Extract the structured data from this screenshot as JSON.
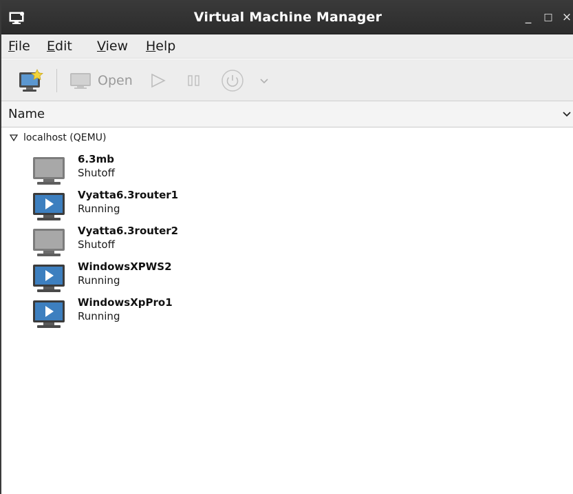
{
  "window": {
    "title": "Virtual Machine Manager",
    "minimize_label": "_",
    "maximize_label": "□",
    "close_label": "×"
  },
  "menubar": {
    "items": [
      {
        "mnemonic": "F",
        "rest": "ile"
      },
      {
        "mnemonic": "E",
        "rest": "dit"
      },
      {
        "mnemonic": "V",
        "rest": "iew"
      },
      {
        "mnemonic": "H",
        "rest": "elp"
      }
    ]
  },
  "toolbar": {
    "open_label": "Open"
  },
  "list": {
    "column_header": "Name",
    "connection": "localhost (QEMU)",
    "vms": [
      {
        "name": "6.3mb",
        "state": "Shutoff"
      },
      {
        "name": "Vyatta6.3router1",
        "state": "Running"
      },
      {
        "name": "Vyatta6.3router2",
        "state": "Shutoff"
      },
      {
        "name": "WindowsXPWS2",
        "state": "Running"
      },
      {
        "name": "WindowsXpPro1",
        "state": "Running"
      }
    ]
  },
  "colors": {
    "titlebar_bg": "#2f2f2f",
    "toolbar_bg": "#ededed",
    "running_screen": "#3d7fbf",
    "shutoff_screen": "#9a9a9a"
  }
}
